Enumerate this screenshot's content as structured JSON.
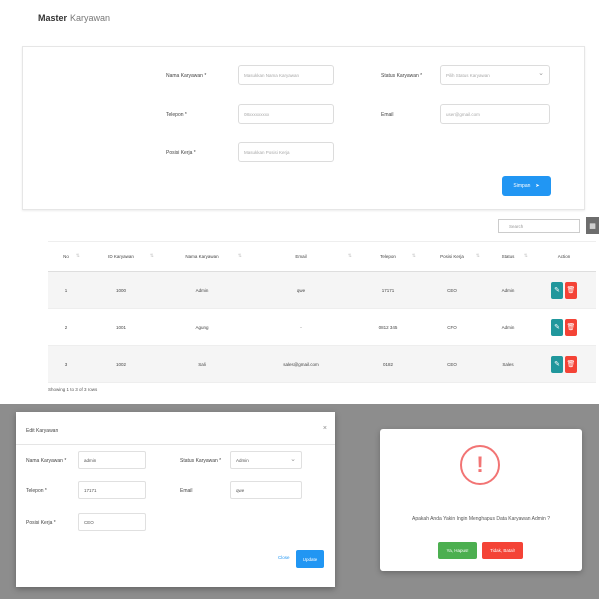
{
  "page": {
    "title": "Master",
    "subtitle": "Karyawan"
  },
  "form": {
    "nama_label": "Nama Karyawan *",
    "nama_placeholder": "Masukkan Nama Karyawan",
    "status_label": "Status Karyawan *",
    "status_placeholder": "Pilih Status Karyawan",
    "telepon_label": "Telepon *",
    "telepon_placeholder": "08xxxxxxxxx",
    "email_label": "Email",
    "email_placeholder": "user@gmail.com",
    "posisi_label": "Posisi Kerja *",
    "posisi_placeholder": "Masukkan Posisi Kerja",
    "submit_label": "Simpan"
  },
  "search": {
    "placeholder": "Search"
  },
  "table": {
    "headers": [
      "No",
      "ID Karyawan",
      "Nama Karyawan",
      "Email",
      "Telepon",
      "Posisi Kerja",
      "Status",
      "Action"
    ],
    "rows": [
      [
        "1",
        "1000",
        "Admin",
        "qwe",
        "17171",
        "CEO",
        "Admin"
      ],
      [
        "2",
        "1001",
        "Agung",
        "-",
        "0812 345",
        "CFO",
        "Admin"
      ],
      [
        "3",
        "1002",
        "Sali",
        "sales@gmail.com",
        "0182",
        "CEO",
        "Sales"
      ]
    ],
    "footer": "Showing 1 to 3 of 3 rows"
  },
  "modal_edit": {
    "title": "Edit Karyawan",
    "close_glyph": "×",
    "nama_label": "Nama Karyawan *",
    "nama_value": "admin",
    "status_label": "Status Karyawan *",
    "status_value": "Admin",
    "telepon_label": "Telepon *",
    "telepon_value": "17171",
    "email_label": "Email",
    "email_value": "qwe",
    "posisi_label": "Posisi Kerja *",
    "posisi_value": "CEO",
    "close_label": "Close",
    "update_label": "Update"
  },
  "confirm": {
    "icon": "!",
    "message": "Apakah Anda Yakin Ingin Menghapus Data Karyawan Admin ?",
    "yes_label": "Ya, Hapus!",
    "no_label": "Tidak, Batal!"
  },
  "colors": {
    "primary": "#2196f3",
    "edit": "#20979c",
    "danger": "#f44336",
    "success": "#4caf50",
    "warning": "#f27474"
  }
}
